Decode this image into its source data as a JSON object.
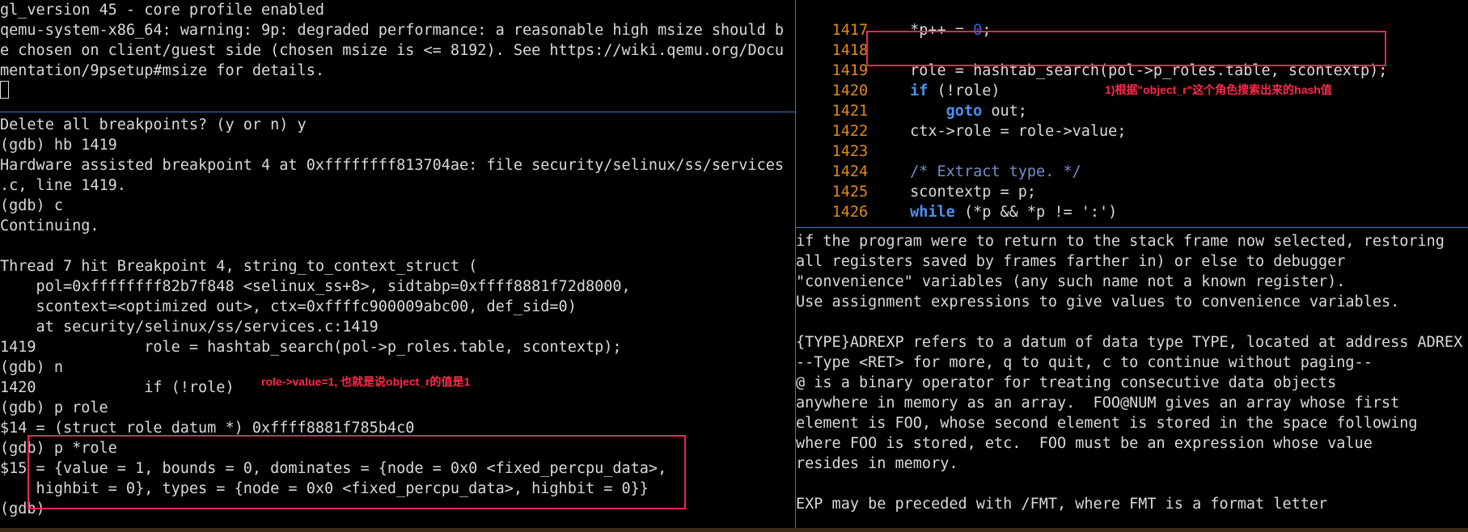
{
  "top_left_terminal": [
    "gl_version 45 - core profile enabled",
    "qemu-system-x86_64: warning: 9p: degraded performance: a reasonable high msize should b",
    "e chosen on client/guest side (chosen msize is <= 8192). See https://wiki.qemu.org/Docu",
    "mentation/9psetup#msize for details."
  ],
  "gdb_console": [
    "Delete all breakpoints? (y or n) y",
    "(gdb) hb 1419",
    "Hardware assisted breakpoint 4 at 0xffffffff813704ae: file security/selinux/ss/services",
    ".c, line 1419.",
    "(gdb) c",
    "Continuing.",
    "",
    "Thread 7 hit Breakpoint 4, string_to_context_struct (",
    "    pol=0xffffffff82b7f848 <selinux_ss+8>, sidtabp=0xffff8881f72d8000,",
    "    scontext=<optimized out>, ctx=0xffffc900009abc00, def_sid=0)",
    "    at security/selinux/ss/services.c:1419",
    "1419            role = hashtab_search(pol->p_roles.table, scontextp);",
    "(gdb) n",
    "1420            if (!role)",
    "(gdb) p role",
    "$14 = (struct role_datum *) 0xffff8881f785b4c0",
    "(gdb) p *role",
    "$15 = {value = 1, bounds = 0, dominates = {node = 0x0 <fixed_percpu_data>,",
    "    highbit = 0}, types = {node = 0x0 <fixed_percpu_data>, highbit = 0}}",
    "(gdb)"
  ],
  "source_view": {
    "lines": [
      {
        "no": "1417",
        "code": "    *p++ = ",
        "num": "0",
        "tail": ";"
      },
      {
        "no": "1418",
        "code": ""
      },
      {
        "no": "1419",
        "code": "    role = hashtab_search(pol->p_roles.table, scontextp);"
      },
      {
        "no": "1420",
        "kw": "    if",
        "code": " (!role)"
      },
      {
        "no": "1421",
        "kw": "        goto",
        "code": " out;"
      },
      {
        "no": "1422",
        "code": "    ctx->role = role->value;"
      },
      {
        "no": "1423",
        "code": ""
      },
      {
        "no": "1424",
        "cmt": "    /* Extract type. */"
      },
      {
        "no": "1425",
        "code": "    scontextp = p;"
      },
      {
        "no": "1426",
        "kw": "    while",
        "code": " (*p && *p != ':')"
      }
    ]
  },
  "help_text": [
    "if the program were to return to the stack frame now selected, restoring",
    "all registers saved by frames farther in) or else to debugger",
    "\"convenience\" variables (any such name not a known register).",
    "Use assignment expressions to give values to convenience variables.",
    "",
    "{TYPE}ADREXP refers to a datum of data type TYPE, located at address ADREX",
    "--Type <RET> for more, q to quit, c to continue without paging--",
    "@ is a binary operator for treating consecutive data objects",
    "anywhere in memory as an array.  FOO@NUM gives an array whose first",
    "element is FOO, whose second element is stored in the space following",
    "where FOO is stored, etc.  FOO must be an expression whose value",
    "resides in memory.",
    "",
    "EXP may be preceded with /FMT, where FMT is a format letter"
  ],
  "annotations": {
    "role_value": "role->value=1, 也就是说object_r的值是1",
    "hash_search": "1)根据\"object_r\"这个角色搜索出来的hash值"
  },
  "colors": {
    "background": "#000000",
    "text": "#d9d9d9",
    "divider": "#3b78c8",
    "line_numbers": "#e08a1a",
    "keywords": "#4f8ff2",
    "highlight_box": "#e5285a",
    "annotation": "#ff2a4a"
  }
}
